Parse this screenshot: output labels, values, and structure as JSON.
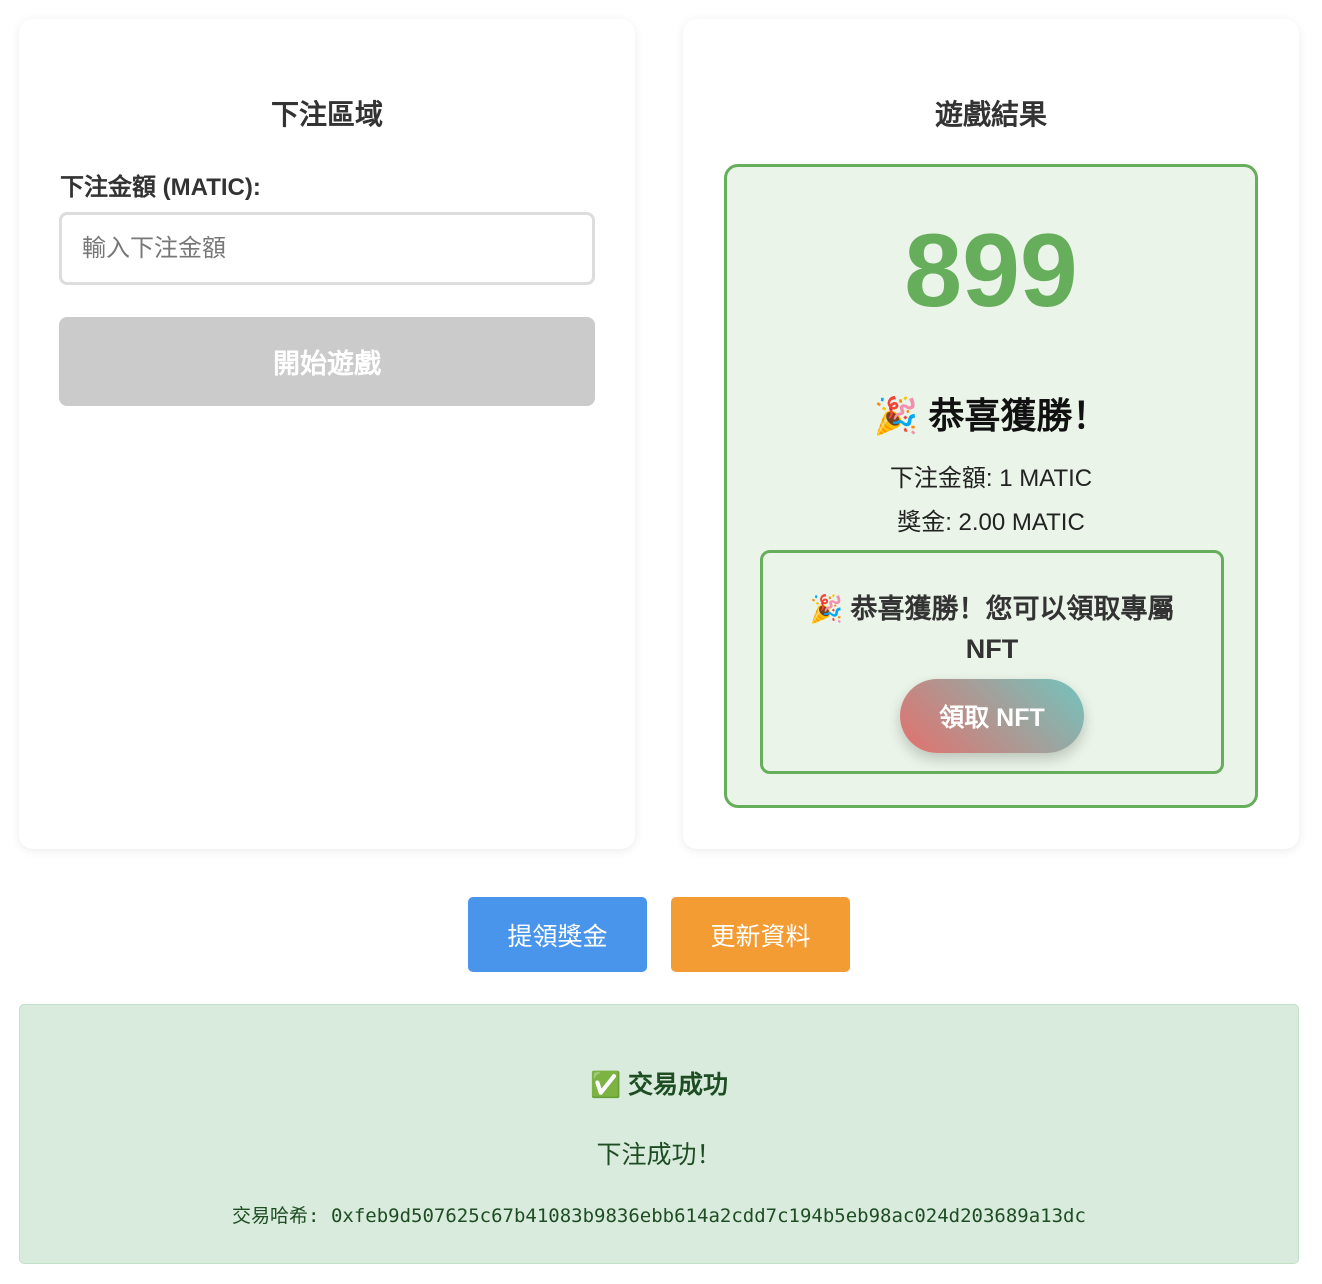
{
  "bet": {
    "title": "下注區域",
    "amount_label": "下注金額 (MATIC):",
    "amount_placeholder": "輸入下注金額",
    "amount_value": "",
    "start_button": "開始遊戲"
  },
  "result": {
    "title": "遊戲結果",
    "number": "899",
    "win_text": "🎉 恭喜獲勝！",
    "bet_amount": "下注金額: 1 MATIC",
    "prize": "獎金: 2.00 MATIC",
    "nft_message": "🎉 恭喜獲勝！您可以領取專屬 NFT",
    "nft_button": "領取 NFT"
  },
  "actions": {
    "withdraw": "提領獎金",
    "refresh": "更新資料"
  },
  "status": {
    "title": "✅ 交易成功",
    "message": "下注成功！",
    "hash_label": "交易哈希:",
    "hash": "0xfeb9d507625c67b41083b9836ebb614a2cdd7c194b5eb98ac024d203689a13dc"
  },
  "colors": {
    "win": "#66ad5c",
    "withdraw": "#4a95ec",
    "refresh": "#f39c33",
    "success_bg": "#d9ebdc"
  }
}
